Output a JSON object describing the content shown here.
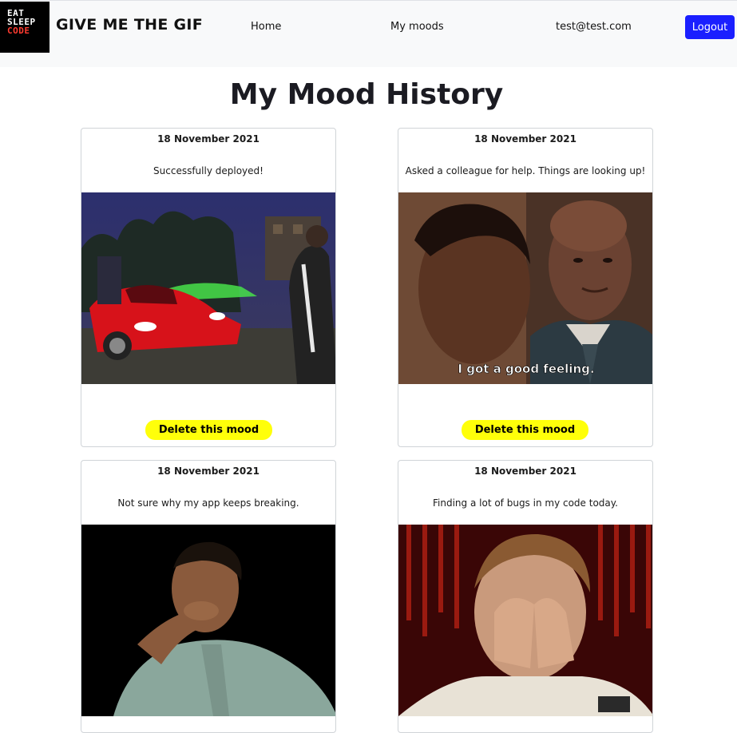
{
  "brand": {
    "logo_lines": [
      "EAT",
      "SLEEP",
      "CODE"
    ],
    "name": "GIVE ME THE GIF"
  },
  "nav": {
    "home": "Home",
    "moods": "My moods",
    "email": "test@test.com",
    "logout": "Logout"
  },
  "page": {
    "title": "My Mood History"
  },
  "moods": [
    {
      "date": "18 November 2021",
      "text": "Successfully deployed!",
      "gif": "red sports car at night",
      "delete_label": "Delete this mood"
    },
    {
      "date": "18 November 2021",
      "text": "Asked a colleague for help. Things are looking up!",
      "gif": "man saying I got a good feeling",
      "caption": "I got a good feeling.",
      "delete_label": "Delete this mood"
    },
    {
      "date": "18 November 2021",
      "text": "Not sure why my app keeps breaking.",
      "gif": "man laughing with hand over mouth"
    },
    {
      "date": "18 November 2021",
      "text": "Finding a lot of bugs in my code today.",
      "gif": "man rubbing eyes in frustration"
    }
  ],
  "colors": {
    "navbar_bg": "#f8f9fa",
    "logout_bg": "#1a1fff",
    "delete_bg": "#ffff0a"
  }
}
